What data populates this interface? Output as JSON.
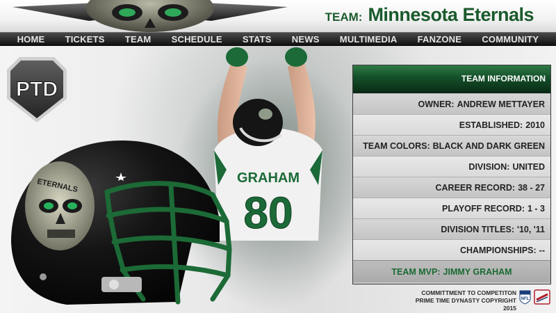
{
  "header": {
    "team_label": "TEAM:",
    "team_name": "Minnesota Eternals"
  },
  "nav": {
    "items": [
      "HOME",
      "TICKETS",
      "TEAM",
      "SCHEDULE",
      "STATS",
      "NEWS",
      "MULTIMEDIA",
      "FANZONE",
      "COMMUNITY"
    ]
  },
  "badge": {
    "text": "PTD"
  },
  "player": {
    "name": "GRAHAM",
    "number": "80"
  },
  "helmet": {
    "text": "ETERNALS"
  },
  "info": {
    "title": "TEAM INFORMATION",
    "rows": [
      {
        "label": "OWNER:",
        "value": "ANDREW METTAYER"
      },
      {
        "label": "ESTABLISHED:",
        "value": "2010"
      },
      {
        "label": "TEAM COLORS:",
        "value": "BLACK AND DARK GREEN"
      },
      {
        "label": "DIVISION:",
        "value": "UNITED"
      },
      {
        "label": "CAREER RECORD:",
        "value": "38 - 27"
      },
      {
        "label": "PLAYOFF RECORD:",
        "value": "1 - 3"
      },
      {
        "label": "DIVISION TITLES:",
        "value": "'10, '11"
      },
      {
        "label": "CHAMPIONSHIPS:",
        "value": "--"
      }
    ],
    "mvp_label": "TEAM MVP:",
    "mvp_value": "JIMMY GRAHAM"
  },
  "footer": {
    "line1": "COMMITTMENT TO COMPETITON",
    "line2": "PRIME TIME DYNASTY COPYRIGHT 2015",
    "nfl_text": "NFL"
  },
  "colors": {
    "team_green": "#1a5a2c",
    "nav_bg": "#1c1c1c",
    "panel_header": "#14502a",
    "mvp_text": "#1a6a33"
  }
}
